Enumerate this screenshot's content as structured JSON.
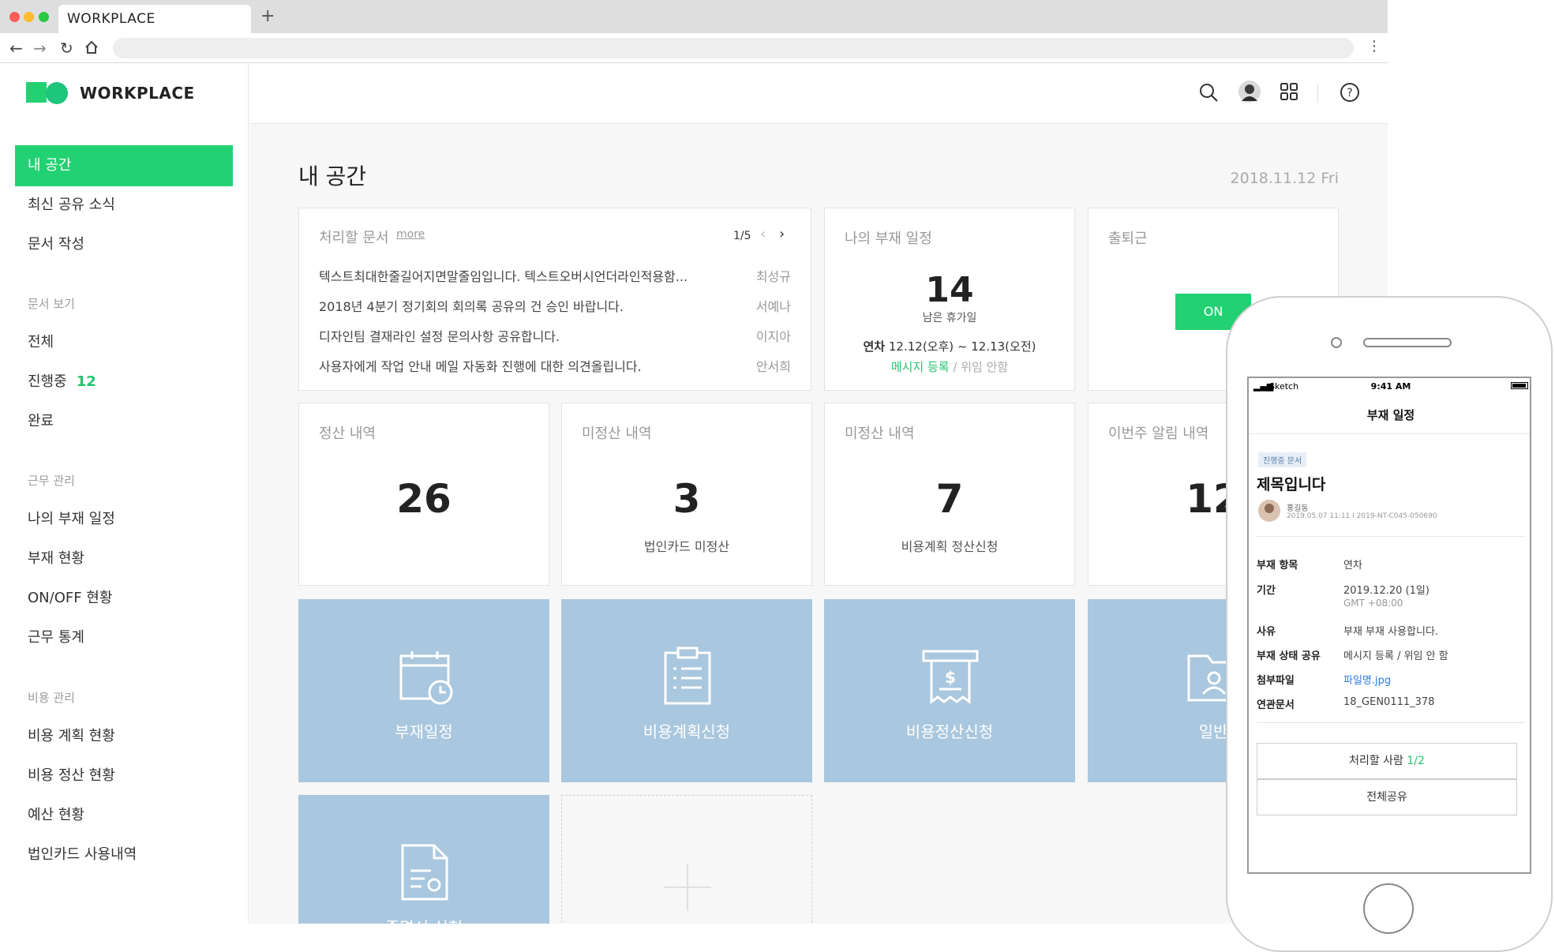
{
  "browser": {
    "tab_title": "WORKPLACE",
    "new_tab": "+"
  },
  "sidebar": {
    "logo": "WORKPLACE",
    "items": [
      {
        "label": "내 공간"
      },
      {
        "label": "최신 공유 소식"
      },
      {
        "label": "문서 작성"
      }
    ],
    "sections": {
      "docs": {
        "title": "문서 보기",
        "items": [
          "전체",
          "진행중",
          "완료"
        ],
        "in_progress_count": "12"
      },
      "work": {
        "title": "근무 관리",
        "items": [
          "나의 부재 일정",
          "부재 현황",
          "ON/OFF 현황",
          "근무 통계"
        ]
      },
      "cost": {
        "title": "비용 관리",
        "items": [
          "비용 계획 현황",
          "비용 정산 현황",
          "예산 현황",
          "법인카드 사용내역"
        ]
      }
    }
  },
  "main": {
    "title": "내 공간",
    "date": "2018.11.12 Fri",
    "docs_card": {
      "title": "처리할 문서",
      "more": "more",
      "pager": "1/5",
      "rows": [
        {
          "text": "텍스트최대한줄길어지면말줄임입니다. 텍스트오버시언더라인적용함...",
          "name": "최성규"
        },
        {
          "text": "2018년 4분기 정기회의 회의록 공유의 건 승인 바랍니다.",
          "name": "서예나"
        },
        {
          "text": "디자인팀 결재라인 설정 문의사항 공유합니다.",
          "name": "이지아"
        },
        {
          "text": "사용자에게 작업 안내 메일 자동화 진행에 대한 의견올립니다.",
          "name": "안서희"
        }
      ]
    },
    "absence_card": {
      "title": "나의 부재 일정",
      "number": "14",
      "sub": "남은 휴가일",
      "leave_bold": "연차",
      "leave_range": "12.12(오후) ~ 12.13(오전)",
      "link_register": "메시지 등록",
      "sep": " / ",
      "link_delegate": "위임 안함"
    },
    "commute_card": {
      "title": "출퇴근",
      "button": "ON"
    },
    "stats": [
      {
        "title": "정산 내역",
        "value": "26",
        "sub": ""
      },
      {
        "title": "미정산 내역",
        "value": "3",
        "sub": "법인카드 미정산"
      },
      {
        "title": "미정산 내역",
        "value": "7",
        "sub": "비용계획 정산신청"
      },
      {
        "title": "이번주 알림 내역",
        "value": "12",
        "sub": ""
      }
    ],
    "tiles": [
      {
        "label": "부재일정",
        "icon": "calendar-clock-icon"
      },
      {
        "label": "비용계획신청",
        "icon": "clipboard-list-icon"
      },
      {
        "label": "비용정산신청",
        "icon": "receipt-dollar-icon"
      },
      {
        "label": "일반",
        "icon": "folder-user-icon"
      },
      {
        "label": "증명서 신청",
        "icon": "document-gear-icon"
      }
    ]
  },
  "phone": {
    "status_left": "Sketch",
    "status_time": "9:41 AM",
    "nav_title": "부재 일정",
    "badge": "진행중 문서",
    "doc_title": "제목입니다",
    "author": "홍길동",
    "meta": "2019.05.07 11:11 I 2019-NT-C045-050690",
    "fields": [
      {
        "label": "부재 항목",
        "value": "연차"
      },
      {
        "label": "기간",
        "value": "2019.12.20 (1일)",
        "extra": "GMT +08:00"
      },
      {
        "label": "사유",
        "value": "부재 부재 사용합니다."
      },
      {
        "label": "부재 상태 공유",
        "value": "메시지 등록 /  위임 안 함"
      },
      {
        "label": "첨부파일",
        "value": "파일명.jpg"
      },
      {
        "label": "연관문서",
        "value": "18_GEN0111_378"
      }
    ],
    "btn_process": "처리할 사람",
    "btn_process_count": "1/2",
    "btn_share": "전체공유"
  }
}
